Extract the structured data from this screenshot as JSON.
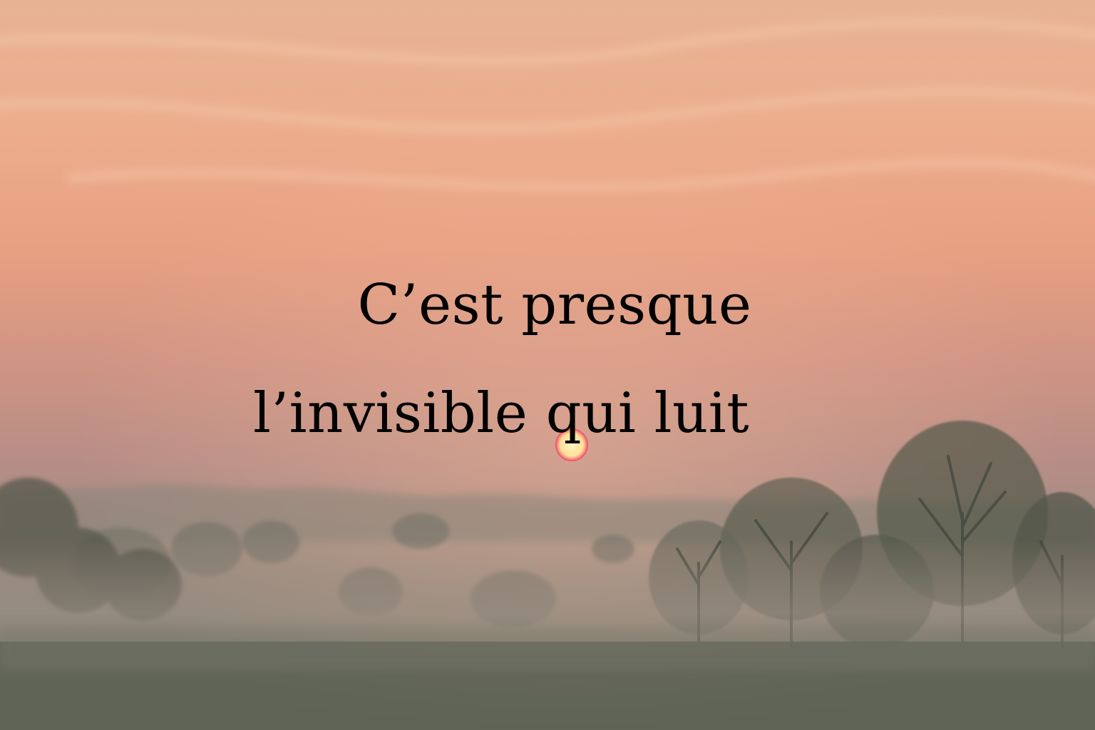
{
  "quote": {
    "line1": "C’est presque",
    "line2": "l’invisible qui luit"
  },
  "colors": {
    "sky_top": "#e8b394",
    "sky_mid": "#e9a184",
    "sky_horizon": "#b98e86",
    "fog": "#9d8e80",
    "ground": "#5f6457",
    "tree": "#4a5145",
    "sun_core": "#fff0b8",
    "sun_rim": "#f0436a",
    "text": "#000000"
  },
  "icons": [
    "sun-icon"
  ]
}
